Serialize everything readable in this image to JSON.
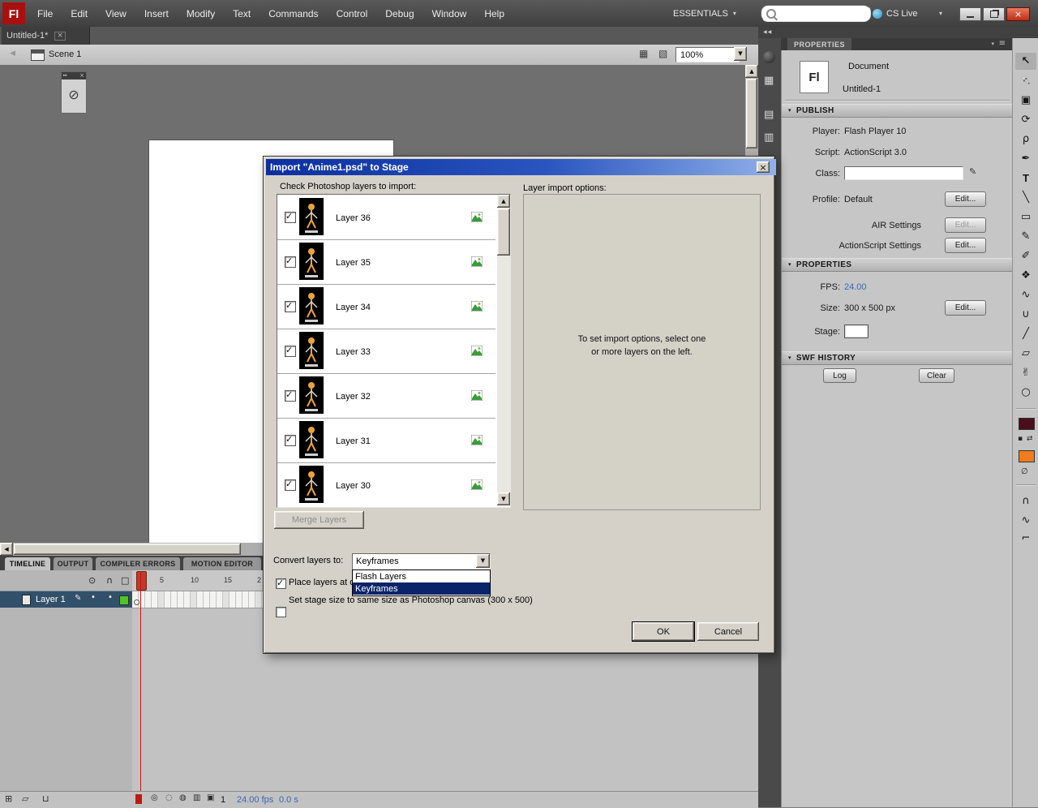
{
  "colors": {
    "titlebar_blue": "#0b2f9e",
    "selection_blue": "#0a246a",
    "fill_swatch": "#f07c1e",
    "stroke_swatch": "#4a0d1c",
    "layer_row_blue": "#33506b",
    "outline_swatch_green": "#55c228",
    "hot_text_blue": "#3b66b5",
    "playhead_red": "#c01818"
  },
  "menubar": {
    "logo": "Fl",
    "items": [
      "File",
      "Edit",
      "View",
      "Insert",
      "Modify",
      "Text",
      "Commands",
      "Control",
      "Debug",
      "Window",
      "Help"
    ],
    "workspace": "ESSENTIALS",
    "cs_live": "CS Live"
  },
  "tabbar": {
    "document_tab": "Untitled-1*"
  },
  "editbar": {
    "scene": "Scene 1",
    "zoom": "100%"
  },
  "dialog": {
    "title": "Import \"Anime1.psd\" to Stage",
    "check_label": "Check Photoshop layers to import:",
    "options_label": "Layer import options:",
    "options_hint_line1": "To set import options, select one",
    "options_hint_line2": "or more layers on the left.",
    "layers": [
      {
        "name": "Layer 36",
        "checked": true
      },
      {
        "name": "Layer 35",
        "checked": true
      },
      {
        "name": "Layer 34",
        "checked": true
      },
      {
        "name": "Layer 33",
        "checked": true
      },
      {
        "name": "Layer 32",
        "checked": true
      },
      {
        "name": "Layer 31",
        "checked": true
      },
      {
        "name": "Layer 30",
        "checked": true
      }
    ],
    "merge_layers_button": "Merge Layers",
    "convert_label": "Convert layers to:",
    "convert_value": "Keyframes",
    "convert_options": [
      "Flash Layers",
      "Keyframes"
    ],
    "place_layers_checkbox": "Place layers at o",
    "stage_size_checkbox": "Set stage size to same size as Photoshop canvas (300 x 500)",
    "ok_button": "OK",
    "cancel_button": "Cancel"
  },
  "timeline": {
    "tabs": [
      "TIMELINE",
      "OUTPUT",
      "COMPILER ERRORS",
      "MOTION EDITOR"
    ],
    "layer_name": "Layer 1",
    "ruler_ticks": [
      "5",
      "10",
      "15",
      "2"
    ],
    "current_frame": "1",
    "frame_rate": "24.00 fps",
    "elapsed_time": "0.0 s"
  },
  "properties_panel": {
    "tab": "PROPERTIES",
    "doc_icon": "Fl",
    "doc_type": "Document",
    "doc_name": "Untitled-1",
    "publish": {
      "title": "PUBLISH",
      "player_label": "Player:",
      "player_value": "Flash Player 10",
      "script_label": "Script:",
      "script_value": "ActionScript 3.0",
      "class_label": "Class:",
      "class_value": "",
      "profile_label": "Profile:",
      "profile_value": "Default",
      "air_label": "AIR Settings",
      "as_label": "ActionScript Settings",
      "edit_button": "Edit..."
    },
    "properties": {
      "title": "PROPERTIES",
      "fps_label": "FPS:",
      "fps_value": "24.00",
      "size_label": "Size:",
      "size_value": "300 x 500 px",
      "edit_button": "Edit...",
      "stage_label": "Stage:"
    },
    "swf_history": {
      "title": "SWF HISTORY",
      "log_button": "Log",
      "clear_button": "Clear"
    }
  },
  "tools": [
    {
      "name": "selection",
      "glyph": "↖"
    },
    {
      "name": "subselection",
      "glyph": "↖"
    },
    {
      "name": "free-transform",
      "glyph": "▣"
    },
    {
      "name": "3d-rotation",
      "glyph": "⟳"
    },
    {
      "name": "lasso",
      "glyph": "ρ"
    },
    {
      "name": "pen",
      "glyph": "✒"
    },
    {
      "name": "text",
      "glyph": "T"
    },
    {
      "name": "line",
      "glyph": "╲"
    },
    {
      "name": "rectangle",
      "glyph": "▭"
    },
    {
      "name": "pencil",
      "glyph": "✎"
    },
    {
      "name": "brush",
      "glyph": "✐"
    },
    {
      "name": "deco",
      "glyph": "❖"
    },
    {
      "name": "bone",
      "glyph": "∿"
    },
    {
      "name": "paint-bucket",
      "glyph": "∪"
    },
    {
      "name": "eyedropper",
      "glyph": "╱"
    },
    {
      "name": "eraser",
      "glyph": "▱"
    },
    {
      "name": "hand",
      "glyph": "✌"
    },
    {
      "name": "zoom",
      "glyph": "○"
    }
  ],
  "icons": {
    "close": "×",
    "tab_close": "×",
    "down_arrow_small": "▾",
    "combo_arrow": "▼",
    "scroll_up": "▲",
    "scroll_down": "▼",
    "scroll_left": "◀",
    "scroll_right": "▶",
    "back_arrow": "◀",
    "expand_panels": "◀◀",
    "panel_menu": "≡",
    "eye": "⊙",
    "lock": "∩",
    "outline": "□",
    "pencil": "✎",
    "dot": "•",
    "new_layer": "⊞",
    "new_folder": "▱",
    "delete_layer": "⊔",
    "center_frame": "◎",
    "onion_skin": "◌",
    "onion_outline": "◍",
    "edit_multiple_frames": "▥",
    "modify_markers": "▣",
    "mini_panel_glyph": "⊘",
    "mini_panel_arrows": "▸▸",
    "edit_scene": "▦",
    "edit_symbols": "▧",
    "magnet": "∩",
    "smooth": "∿",
    "straighten": "⌐",
    "swap_colors": "⇄",
    "default_colors": "▪",
    "no_color": "∅",
    "grid_panel": "▦",
    "books_panel": "▤",
    "library_panel": "▥"
  }
}
